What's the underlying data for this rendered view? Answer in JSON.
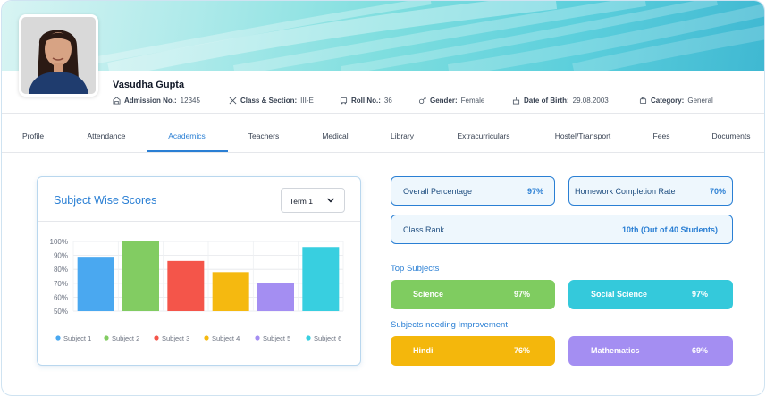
{
  "student": {
    "name": "Vasudha Gupta",
    "admission_label": "Admission No.:",
    "admission_value": "12345",
    "class_label": "Class & Section:",
    "class_value": "III-E",
    "roll_label": "Roll No.:",
    "roll_value": "36",
    "gender_label": "Gender:",
    "gender_value": "Female",
    "dob_label": "Date of Birth:",
    "dob_value": "29.08.2003",
    "category_label": "Category:",
    "category_value": "General"
  },
  "tabs": [
    {
      "label": "Profile"
    },
    {
      "label": "Attendance"
    },
    {
      "label": "Academics"
    },
    {
      "label": "Teachers"
    },
    {
      "label": "Medical"
    },
    {
      "label": "Library"
    },
    {
      "label": "Extracurriculars"
    },
    {
      "label": "Hostel/Transport"
    },
    {
      "label": "Fees"
    },
    {
      "label": "Documents"
    }
  ],
  "active_tab": "Academics",
  "scores_card": {
    "title": "Subject Wise Scores",
    "term_selected": "Term 1"
  },
  "chart_data": {
    "type": "bar",
    "title": "",
    "categories": [
      "Subject 1",
      "Subject 2",
      "Subject 3",
      "Subject 4",
      "Subject 5",
      "Subject 6"
    ],
    "values": [
      89,
      100,
      86,
      78,
      70,
      96
    ],
    "colors": [
      "#4aa8f0",
      "#82cc62",
      "#f4554a",
      "#f5b910",
      "#a48ef2",
      "#38cfe0"
    ],
    "ylim": [
      50,
      100
    ],
    "yticks": [
      "50%",
      "60%",
      "70%",
      "80%",
      "90%",
      "100%"
    ],
    "grid": true,
    "legend": "bottom"
  },
  "stats": {
    "overall_label": "Overall Percentage",
    "overall_value": "97%",
    "homework_label": "Homework Completion Rate",
    "homework_value": "70%",
    "rank_label": "Class Rank",
    "rank_value": "10th (Out of 40 Students)"
  },
  "top_subjects": {
    "title": "Top Subjects",
    "items": [
      {
        "label": "Science",
        "value": "97%",
        "color": "#7fcc60"
      },
      {
        "label": "Social Science",
        "value": "97%",
        "color": "#34c9db"
      }
    ]
  },
  "improvement": {
    "title": "Subjects needing Improvement",
    "items": [
      {
        "label": "Hindi",
        "value": "76%",
        "color": "#f4b70c"
      },
      {
        "label": "Mathematics",
        "value": "69%",
        "color": "#a48ef2"
      }
    ]
  },
  "colors": {
    "accent": "#2a7fd4",
    "accent_light": "#eef7fd"
  }
}
